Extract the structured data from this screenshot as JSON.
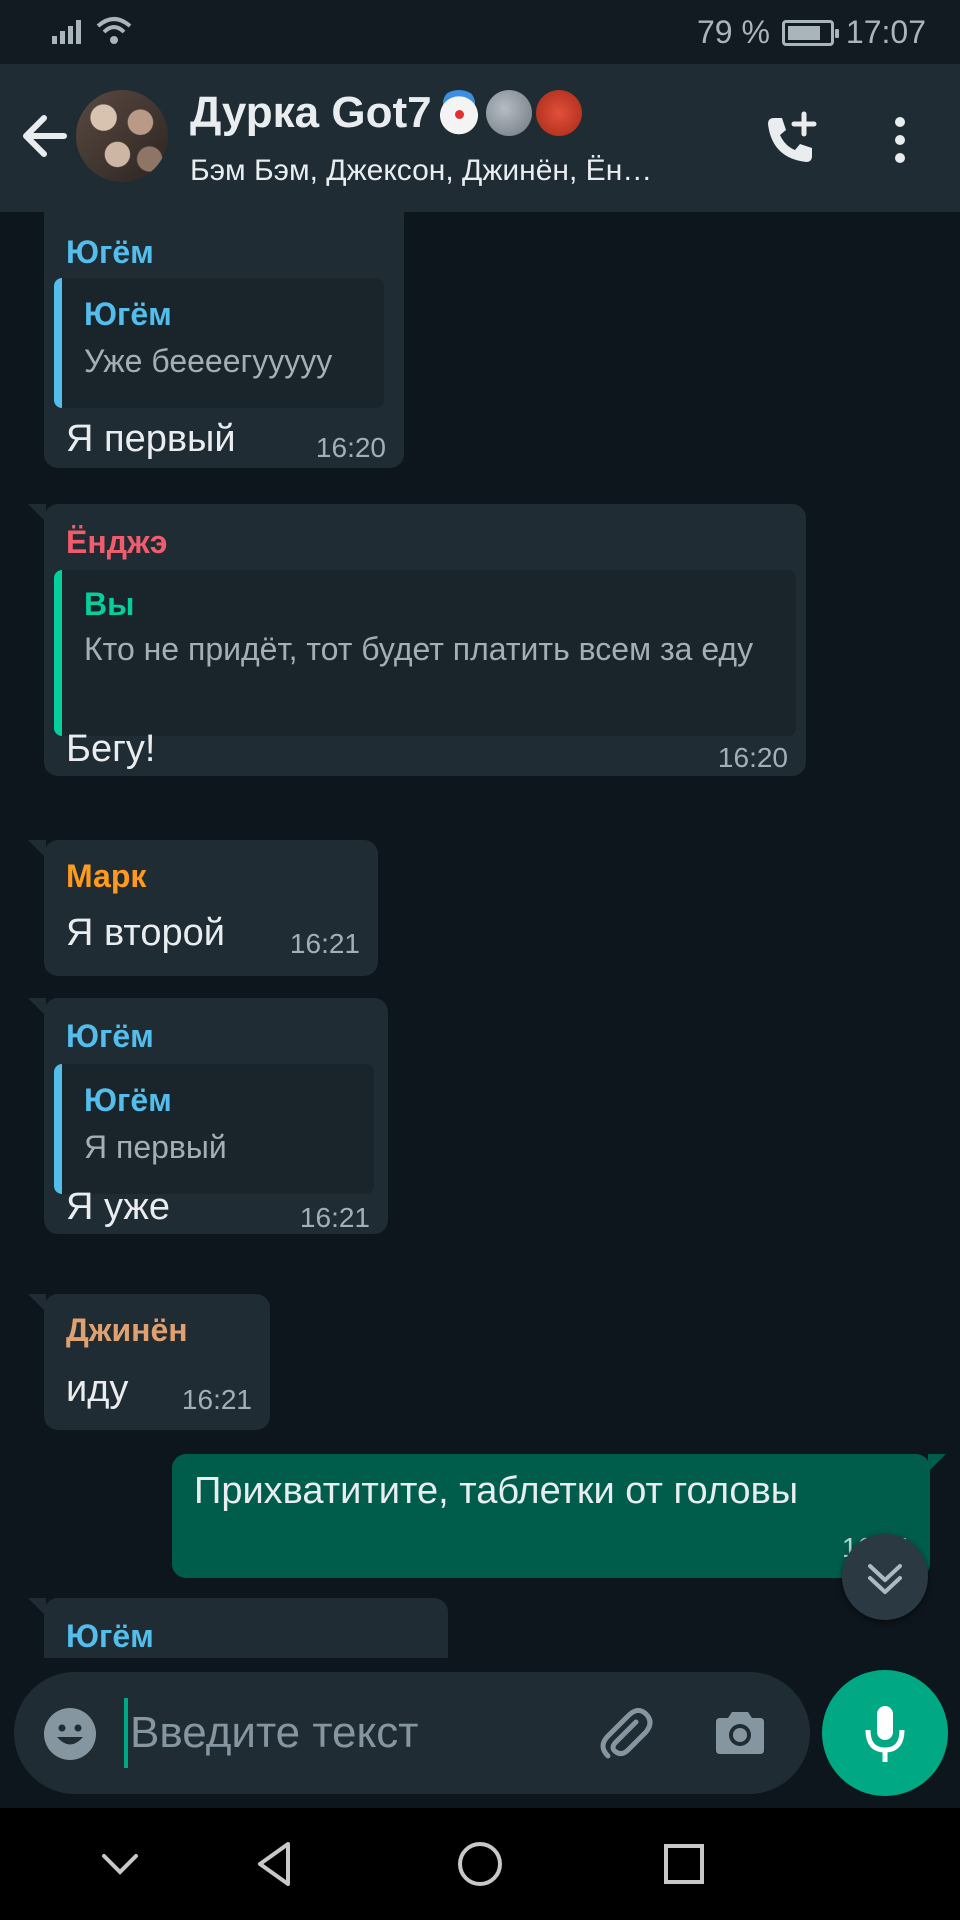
{
  "status_bar": {
    "battery_percent": "79 %",
    "battery_level": 0.79,
    "time": "17:07"
  },
  "header": {
    "title": "Дурка Got7",
    "title_emojis": [
      "clown-emoji",
      "new-moon-face-emoji",
      "ogre-emoji"
    ],
    "subtitle": "Бэм Бэм, Джексон, Джинён, Ён…"
  },
  "colors": {
    "accent": "#00a884",
    "name_ugyom": "#53bdeb",
    "name_yongje": "#f15c6d",
    "name_mark": "#ff9a1f",
    "name_jinyoung": "#e0a070",
    "quote_you": "#06cf9c"
  },
  "messages": [
    {
      "sender": "Югём",
      "quote_name": "Югём",
      "quote_text": "Уже беееегууууу",
      "text": "Я первый",
      "time": "16:20"
    },
    {
      "sender": "Ёнджэ",
      "quote_name": "Вы",
      "quote_text": "Кто не придёт, тот будет платить всем за еду",
      "text": "Бегу!",
      "time": "16:20"
    },
    {
      "sender": "Марк",
      "text": "Я второй",
      "time": "16:21"
    },
    {
      "sender": "Югём",
      "quote_name": "Югём",
      "quote_text": "Я первый",
      "text": "Я уже",
      "time": "16:21"
    },
    {
      "sender": "Джинён",
      "text": "иду",
      "time": "16:21"
    },
    {
      "outgoing": true,
      "text": "Прихватитите, таблетки от головы",
      "time": "16:21"
    },
    {
      "sender": "Югём"
    }
  ],
  "input": {
    "placeholder": "Введите текст"
  }
}
